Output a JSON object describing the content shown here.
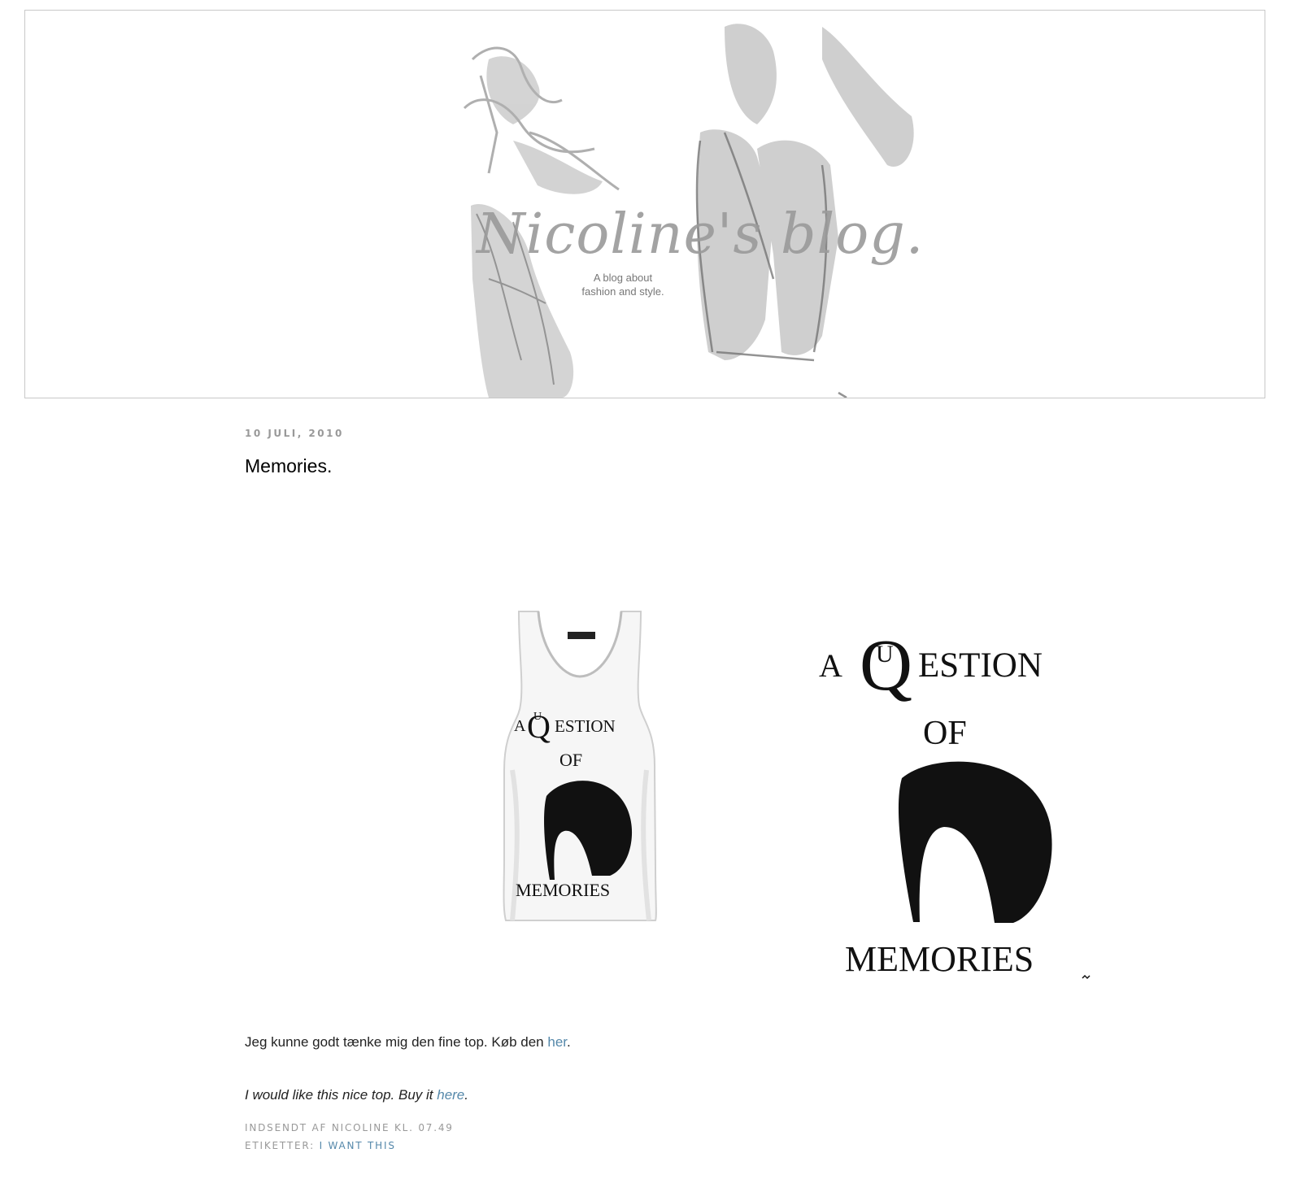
{
  "header": {
    "title": "Nicoline's blog.",
    "description_line1": "A blog about",
    "description_line2": "fashion and style."
  },
  "post": {
    "date": "10 JULI, 2010",
    "title": "Memories.",
    "product_print": {
      "line1_a": "A",
      "line1_q": "Q",
      "line1_u": "U",
      "line1_rest": "ESTION",
      "line2": "OF",
      "line3": "MEMORIES"
    },
    "body_da_text": "Jeg kunne godt tænke mig den fine top. Køb den ",
    "body_da_link": "her",
    "body_da_end": ".",
    "body_en_text": "I would like this nice top. Buy it ",
    "body_en_link": "here",
    "body_en_end": ".",
    "footer_posted": "INDSENDT AF NICOLINE KL. 07.49",
    "footer_labels_prefix": "ETIKETTER: ",
    "footer_label_link": "I WANT THIS"
  },
  "colors": {
    "link": "#5588aa",
    "meta": "#999999",
    "header_border": "#c8c8c8"
  }
}
